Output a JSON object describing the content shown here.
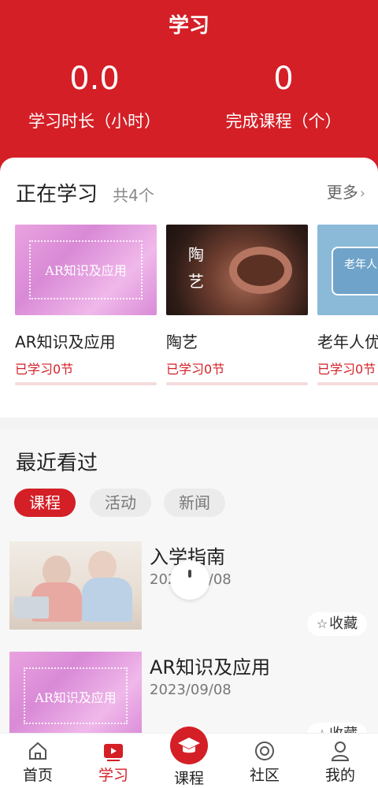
{
  "header": {
    "title": "学习",
    "study_hours_value": "0.0",
    "study_hours_label": "学习时长（小时）",
    "completed_value": "0",
    "completed_label": "完成课程（个）"
  },
  "learning": {
    "title": "正在学习",
    "count": "共4个",
    "more": "更多",
    "courses": [
      {
        "name": "AR知识及应用",
        "progress": "已学习0节",
        "thumb_text": "AR知识及应用"
      },
      {
        "name": "陶艺",
        "progress": "已学习0节",
        "thumb_text": "陶艺"
      },
      {
        "name": "老年人优",
        "progress": "已学习0节",
        "thumb_text": "老年人"
      }
    ]
  },
  "recent": {
    "title": "最近看过",
    "tabs": [
      "课程",
      "活动",
      "新闻"
    ],
    "items": [
      {
        "title": "入学指南",
        "date": "2023/09/08",
        "fav": "收藏"
      },
      {
        "title": "AR知识及应用",
        "date": "2023/09/08",
        "fav": "收藏",
        "thumb_text": "AR知识及应用"
      }
    ]
  },
  "nav": {
    "items": [
      {
        "label": "首页",
        "icon": "home-icon"
      },
      {
        "label": "学习",
        "icon": "play-icon"
      },
      {
        "label": "课程",
        "icon": "graduation-cap-icon"
      },
      {
        "label": "社区",
        "icon": "community-icon"
      },
      {
        "label": "我的",
        "icon": "profile-icon"
      }
    ]
  },
  "colors": {
    "accent": "#d41f26"
  }
}
